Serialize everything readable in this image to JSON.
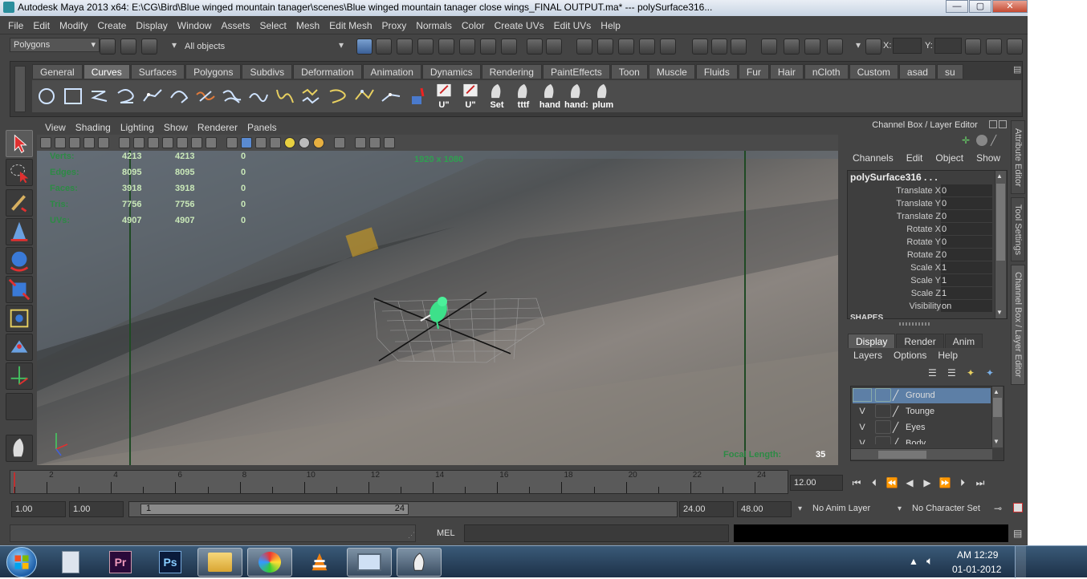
{
  "window": {
    "title": "Autodesk Maya 2013 x64: E:\\CG\\Bird\\Blue winged mountain tanager\\scenes\\Blue winged mountain tanager close wings_FINAL OUTPUT.ma*   ---   polySurface316...",
    "min": "—",
    "max": "▢",
    "close": "✕"
  },
  "menu": [
    "File",
    "Edit",
    "Modify",
    "Create",
    "Display",
    "Window",
    "Assets",
    "Select",
    "Mesh",
    "Edit Mesh",
    "Proxy",
    "Normals",
    "Color",
    "Create UVs",
    "Edit UVs",
    "Help"
  ],
  "status": {
    "menuset": "Polygons",
    "selection": "All objects",
    "x_label": "X:",
    "y_label": "Y:"
  },
  "shelf": {
    "tabs": [
      "General",
      "Curves",
      "Surfaces",
      "Polygons",
      "Subdivs",
      "Deformation",
      "Animation",
      "Dynamics",
      "Rendering",
      "PaintEffects",
      "Toon",
      "Muscle",
      "Fluids",
      "Fur",
      "Hair",
      "nCloth",
      "Custom",
      "asad",
      "su"
    ],
    "labels": {
      "u1": "U\"",
      "u2": "U\"",
      "set": "Set",
      "tttf": "tttf",
      "hand1": "hand",
      "hand2": "hand:",
      "plum": "plum"
    }
  },
  "panel": {
    "menu": [
      "View",
      "Shading",
      "Lighting",
      "Show",
      "Renderer",
      "Panels"
    ]
  },
  "hud": {
    "resolution": "1920 x 1080",
    "rows": [
      {
        "label": "Verts:",
        "a": "4213",
        "b": "4213",
        "c": "0"
      },
      {
        "label": "Edges:",
        "a": "8095",
        "b": "8095",
        "c": "0"
      },
      {
        "label": "Faces:",
        "a": "3918",
        "b": "3918",
        "c": "0"
      },
      {
        "label": "Tris:",
        "a": "7756",
        "b": "7756",
        "c": "0"
      },
      {
        "label": "UVs:",
        "a": "4907",
        "b": "4907",
        "c": "0"
      }
    ],
    "focal_label": "Focal Length:",
    "focal_value": "35"
  },
  "channelbox": {
    "title": "Channel Box / Layer Editor",
    "menu": [
      "Channels",
      "Edit",
      "Object",
      "Show"
    ],
    "object": "polySurface316 . . .",
    "channels": [
      {
        "name": "Translate X",
        "value": "0"
      },
      {
        "name": "Translate Y",
        "value": "0"
      },
      {
        "name": "Translate Z",
        "value": "0"
      },
      {
        "name": "Rotate X",
        "value": "0"
      },
      {
        "name": "Rotate Y",
        "value": "0"
      },
      {
        "name": "Rotate Z",
        "value": "0"
      },
      {
        "name": "Scale X",
        "value": "1"
      },
      {
        "name": "Scale Y",
        "value": "1"
      },
      {
        "name": "Scale Z",
        "value": "1"
      },
      {
        "name": "Visibility",
        "value": "on"
      }
    ],
    "shapes": "SHAPES"
  },
  "sidetabs": {
    "attribute": "Attribute Editor",
    "tool": "Tool Settings",
    "channel": "Channel Box / Layer Editor"
  },
  "layers": {
    "tabs": [
      "Display",
      "Render",
      "Anim"
    ],
    "menu": [
      "Layers",
      "Options",
      "Help"
    ],
    "items": [
      {
        "v": "",
        "name": "Ground"
      },
      {
        "v": "V",
        "name": "Tounge"
      },
      {
        "v": "V",
        "name": "Eyes"
      },
      {
        "v": "V",
        "name": "Body"
      }
    ]
  },
  "timeline": {
    "ticks": [
      "2",
      "4",
      "6",
      "8",
      "10",
      "12",
      "14",
      "16",
      "18",
      "20",
      "22",
      "24"
    ],
    "current": "12.00"
  },
  "range": {
    "start": "1.00",
    "inner_start": "1.00",
    "slider_start": "1",
    "slider_end": "24",
    "inner_end": "24.00",
    "end": "48.00",
    "anim_layer": "No Anim Layer",
    "char_set": "No Character Set"
  },
  "cmd": {
    "label": "MEL"
  },
  "tray": {
    "time": "AM 12:29",
    "date": "01-01-2012"
  }
}
